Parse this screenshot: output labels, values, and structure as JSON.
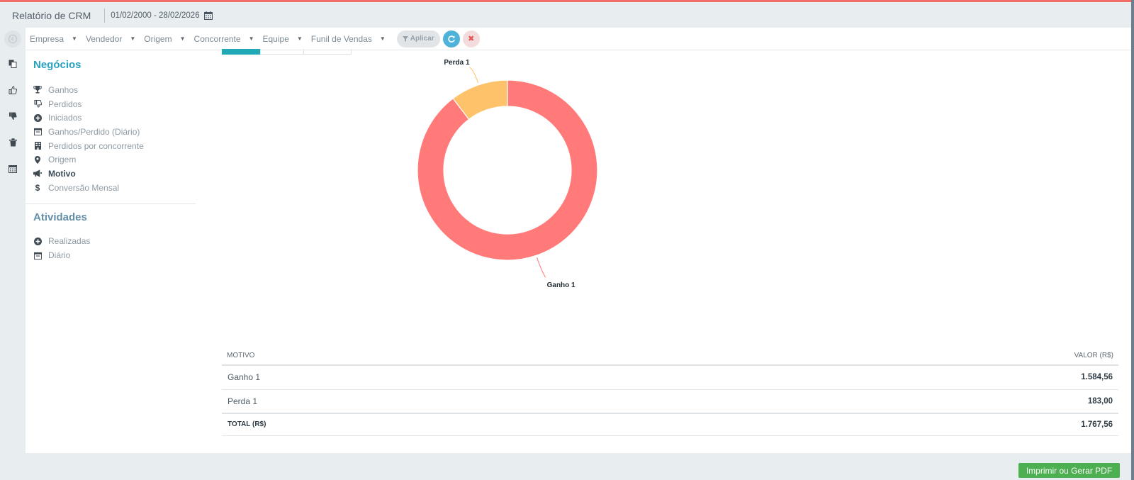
{
  "header": {
    "title": "Relatório de CRM",
    "date_range": "01/02/2000 - 28/02/2026"
  },
  "filters": {
    "items": [
      "Empresa",
      "Vendedor",
      "Origem",
      "Concorrente",
      "Equipe",
      "Funil de Vendas"
    ],
    "apply_label": "Aplicar"
  },
  "sidebar": {
    "section1_title": "Negócios",
    "items": [
      {
        "label": "Ganhos",
        "icon": "trophy-icon"
      },
      {
        "label": "Perdidos",
        "icon": "thumbs-down-icon"
      },
      {
        "label": "Iniciados",
        "icon": "plus-circle-icon"
      },
      {
        "label": "Ganhos/Perdido (Diário)",
        "icon": "calendar-icon"
      },
      {
        "label": "Perdidos por concorrente",
        "icon": "building-icon"
      },
      {
        "label": "Origem",
        "icon": "map-marker-icon"
      },
      {
        "label": "Motivo",
        "icon": "bullhorn-icon"
      },
      {
        "label": "Conversão Mensal",
        "icon": "dollar-icon"
      }
    ],
    "active_item": "Motivo",
    "section2_title": "Atividades",
    "activity_items": [
      {
        "label": "Realizadas",
        "icon": "plus-circle-icon"
      },
      {
        "label": "Diário",
        "icon": "calendar-icon"
      }
    ]
  },
  "chart_data": {
    "type": "pie",
    "style": "donut",
    "labels": [
      "Ganho 1",
      "Perda 1"
    ],
    "values": [
      1584.56,
      183.0
    ],
    "colors": [
      "#ff7a78",
      "#fec36a"
    ]
  },
  "table": {
    "col_motivo": "MOTIVO",
    "col_valor": "VALOR (R$)",
    "rows": [
      {
        "motivo": "Ganho 1",
        "valor": "1.584,56"
      },
      {
        "motivo": "Perda 1",
        "valor": "183,00"
      }
    ],
    "total_label": "TOTAL (R$)",
    "total_value": "1.767,56"
  },
  "actions": {
    "print_label": "Imprimir ou Gerar PDF"
  },
  "colors": {
    "accent_top": "#ef6e68",
    "section_title": "#28a3bb",
    "print_button": "#4caf50",
    "refresh_button": "#4fb3d9"
  }
}
